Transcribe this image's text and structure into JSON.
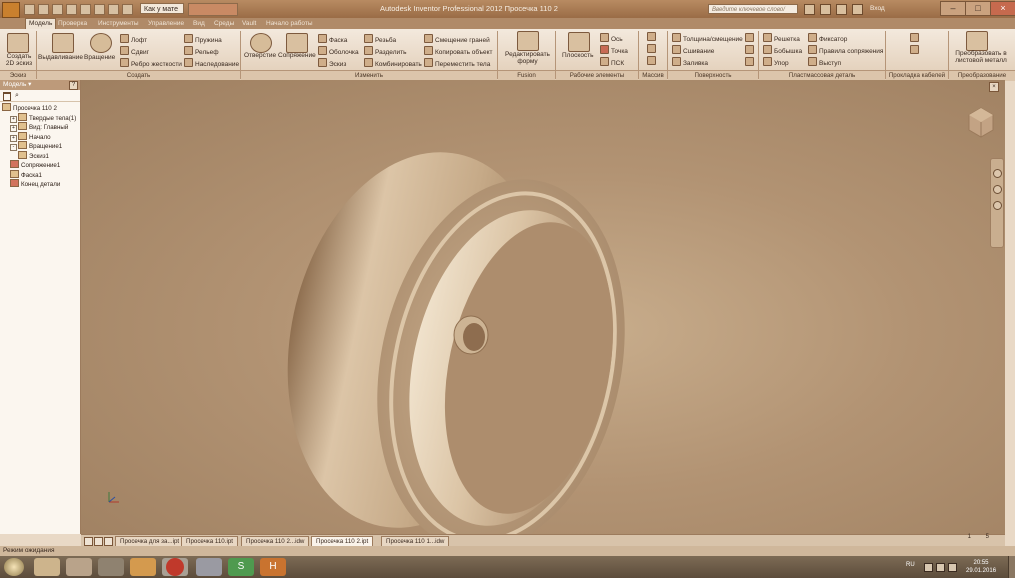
{
  "titlebar": {
    "qa_select": "Как у мате",
    "window_title": "Autodesk Inventor Professional 2012   Просечка 110 2",
    "search_placeholder": "Введите ключевое слово/фразу",
    "login": "Вход"
  },
  "tabs": [
    "Модель",
    "Проверка",
    "Инструменты",
    "Управление",
    "Вид",
    "Среды",
    "Vault",
    "Начало работы"
  ],
  "ribbon": {
    "sketch": {
      "create_2d_sketch": "Создать 2D эскиз",
      "group": "Эскиз"
    },
    "create": {
      "extrude": "Выдавливание",
      "revolve": "Вращение",
      "loft": "Лофт",
      "sweep": "Сдвиг",
      "rib": "Ребро жесткости",
      "coil": "Пружина",
      "emboss": "Рельеф",
      "derive": "Наследование",
      "group": "Создать"
    },
    "modify": {
      "hole": "Отверстие",
      "fillet": "Сопряжение",
      "chamfer": "Фаска",
      "shell": "Оболочка",
      "sketch": "Эскиз",
      "thread": "Резьба",
      "split": "Разделить",
      "combine": "Комбинировать",
      "move_face": "Смещение граней",
      "copy_object": "Копировать объект",
      "move_bodies": "Переместить тела",
      "group": "Изменить"
    },
    "fusion": {
      "edit_form": "Редактировать форму",
      "group": "Fusion"
    },
    "work_features": {
      "plane": "Плоскость",
      "axis": "Ось",
      "point": "Точка",
      "ucs": "ПСК",
      "group": "Рабочие элементы"
    },
    "pattern": {
      "group": "Массив"
    },
    "surface": {
      "thicken": "Толщина/смещение",
      "stitch": "Сшивание",
      "patch": "Заливка",
      "group": "Поверхность"
    },
    "plastic": {
      "grill": "Решетка",
      "boss": "Бобышка",
      "rest": "Упор",
      "snap_fit": "Фиксатор",
      "rule_fillet": "Правила сопряжения",
      "lip": "Выступ",
      "group": "Пластмассовая деталь"
    },
    "cable": {
      "group": "Прокладка кабелей"
    },
    "convert": {
      "to_sheet_metal": "Преобразовать в листовой металл",
      "group": "Преобразование"
    }
  },
  "browser": {
    "title": "Модель",
    "help": "?",
    "tree": [
      {
        "label": "Просечка 110 2",
        "level": 0,
        "icon": "part-icon",
        "expand": ""
      },
      {
        "label": "Твердые тела(1)",
        "level": 1,
        "icon": "solid-bodies-icon",
        "expand": "+"
      },
      {
        "label": "Вид: Главный",
        "level": 1,
        "icon": "view-icon",
        "expand": "+"
      },
      {
        "label": "Начало",
        "level": 1,
        "icon": "origin-folder-icon",
        "expand": "+"
      },
      {
        "label": "Вращение1",
        "level": 1,
        "icon": "revolve-feature-icon",
        "expand": "-"
      },
      {
        "label": "Эскиз1",
        "level": 2,
        "icon": "sketch-icon",
        "expand": ""
      },
      {
        "label": "Сопряжение1",
        "level": 1,
        "icon": "fillet-warning-icon",
        "expand": ""
      },
      {
        "label": "Фаска1",
        "level": 1,
        "icon": "chamfer-feature-icon",
        "expand": ""
      },
      {
        "label": "Конец детали",
        "level": 1,
        "icon": "end-of-part-icon",
        "expand": ""
      }
    ]
  },
  "doc_tabs": [
    {
      "label": "Просечка для за...ipt",
      "active": false
    },
    {
      "label": "Просечка 110.ipt",
      "active": false
    },
    {
      "label": "Просечка 110 2...idw",
      "active": false
    },
    {
      "label": "Просечка 110 2.ipt",
      "active": true
    },
    {
      "label": "Просечка 110 1...idw",
      "active": false
    }
  ],
  "page_counter_a": "1",
  "page_counter_b": "5",
  "status": "Режим ожидания",
  "taskbar": {
    "lang": "RU",
    "time": "20:55",
    "date": "29.01.2016"
  },
  "colors": {
    "accent": "#c9802e",
    "ribbon_bg": "#efe3d4",
    "viewport_bg": "#b29373",
    "close_button": "#c66a4e"
  }
}
